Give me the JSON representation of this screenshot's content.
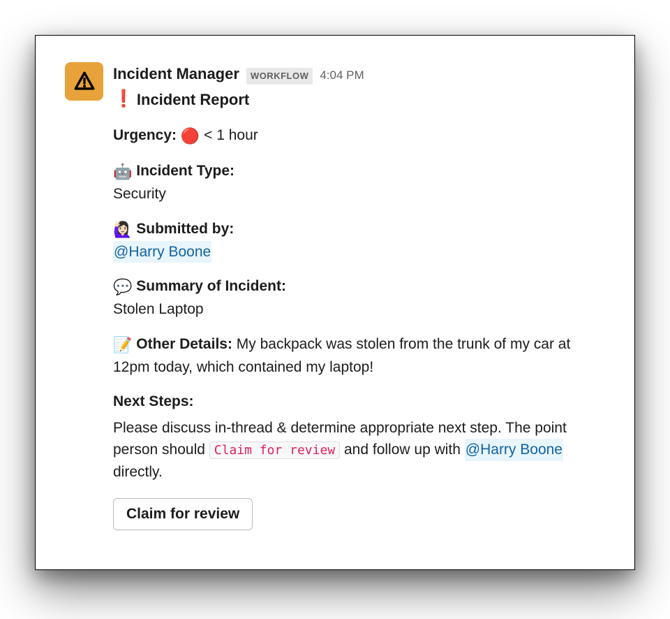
{
  "sender": "Incident Manager",
  "badge": "WORKFLOW",
  "time": "4:04 PM",
  "title": "Incident Report",
  "fields": {
    "urgency": {
      "label": "Urgency:",
      "emoji": "🔴",
      "value": "< 1 hour"
    },
    "type": {
      "emoji": "🤖",
      "label": "Incident Type:",
      "value": "Security"
    },
    "submitted": {
      "emoji": "🙋🏻‍♀️",
      "label": "Submitted by:",
      "mention": "@Harry Boone"
    },
    "summary": {
      "emoji": "💬",
      "label": "Summary of Incident:",
      "value": "Stolen Laptop"
    },
    "details": {
      "emoji": "📝",
      "label": "Other Details:",
      "value": "My backpack was stolen from the trunk of my car at 12pm today, which contained my laptop!"
    }
  },
  "next_steps": {
    "label": "Next Steps:",
    "pre": "Please discuss in-thread & determine appropriate next step. The point person should ",
    "code": "Claim for review",
    "mid": " and follow up with ",
    "mention": "@Harry Boone",
    "post": " directly."
  },
  "button": "Claim for review"
}
